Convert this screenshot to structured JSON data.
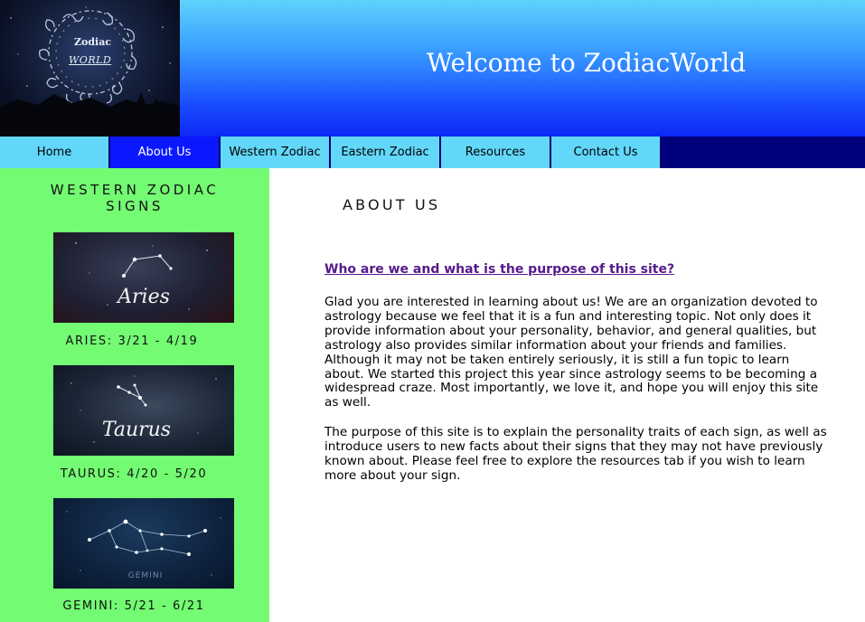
{
  "logo": {
    "line1": "Zodiac",
    "line2": "WORLD"
  },
  "header": {
    "title": "Welcome to ZodiacWorld"
  },
  "nav": {
    "items": [
      {
        "label": "Home",
        "active": false
      },
      {
        "label": "About Us",
        "active": true
      },
      {
        "label": "Western Zodiac",
        "active": false
      },
      {
        "label": "Eastern Zodiac",
        "active": false
      },
      {
        "label": "Resources",
        "active": false
      },
      {
        "label": "Contact Us",
        "active": false
      }
    ]
  },
  "sidebar": {
    "title_line1": "WESTERN ZODIAC",
    "title_line2": "SIGNS",
    "signs": [
      {
        "image_text": "Aries",
        "caption": "ARIES: 3/21 - 4/19"
      },
      {
        "image_text": "Taurus",
        "caption": "TAURUS: 4/20 - 5/20"
      },
      {
        "image_text": "GEMINI",
        "caption": "GEMINI: 5/21 - 6/21"
      }
    ]
  },
  "main": {
    "heading": "ABOUT US",
    "question_link": "Who are we and what is the purpose of this site?",
    "paragraph1_lines": [
      "Glad you are interested in learning about us! We are an organization devoted to",
      "astrology because we feel that it is a fun and interesting topic. Not only does it",
      "provide information about your personality, behavior, and general qualities, but",
      "astrology also provides similar information about your friends and families.",
      "Although it may not be taken entirely seriously, it is still a fun topic to learn",
      "about. We started this project this year since astrology seems to be becoming a",
      "widespread craze. Most importantly, we love it, and hope you will enjoy this site",
      "as well."
    ],
    "paragraph2_lines": [
      "The purpose of this site is to explain the personality traits of each sign, as well as",
      "introduce users to new facts about their signs that they may not have previously",
      "known about. Please feel free to explore the resources tab if you wish to learn",
      "more about your sign."
    ]
  },
  "colors": {
    "nav_bg": "#62d7f9",
    "nav_active": "#0a18ff",
    "sidebar_bg": "#73fb73",
    "link": "#551a8b"
  }
}
